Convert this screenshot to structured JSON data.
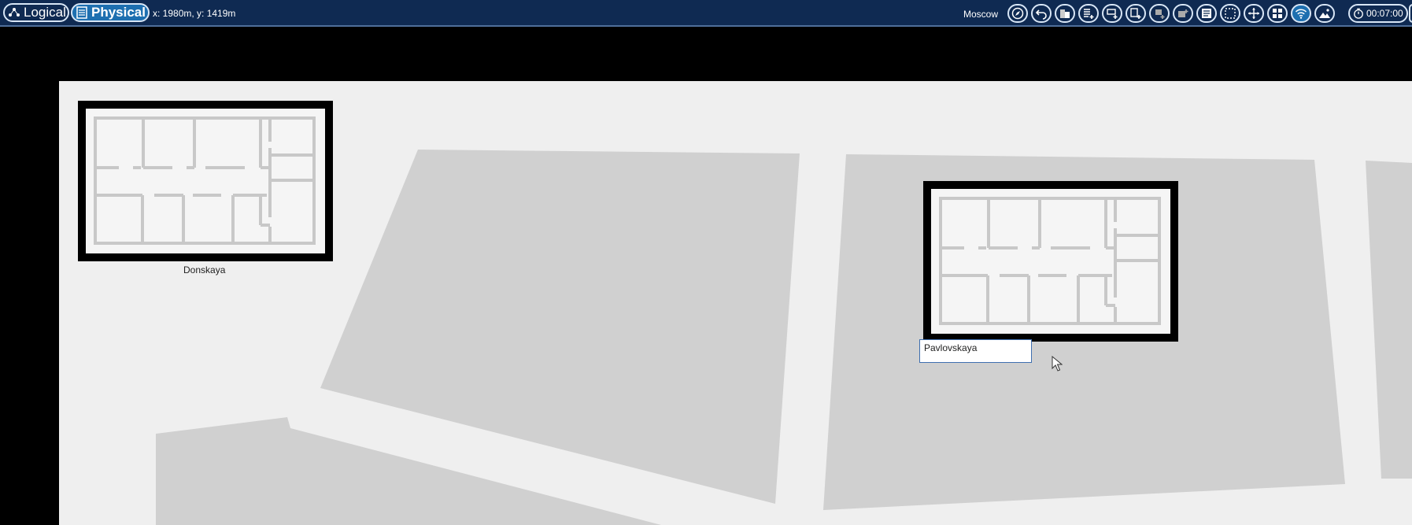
{
  "topbar": {
    "tabs": [
      {
        "label": "Logical",
        "icon": "network-icon",
        "active": false
      },
      {
        "label": "Physical",
        "icon": "list-icon",
        "active": true
      }
    ],
    "coordinates": "x: 1980m, y: 1419m",
    "location": "Moscow",
    "clock": "00:07:00",
    "tools": [
      "compass-icon",
      "undo-icon",
      "building-icon",
      "add-floor-icon",
      "add-room-icon",
      "add-zone-icon",
      "add-device-icon",
      "add-rack-icon",
      "notes-icon",
      "select-icon",
      "move-icon",
      "grid-icon",
      "wifi-icon",
      "background-image-icon",
      "timer-icon"
    ]
  },
  "map": {
    "buildings": [
      {
        "name": "Donskaya"
      },
      {
        "name": "Pavlovskaya",
        "editing": true
      }
    ]
  },
  "colors": {
    "topbar": "#0f2a52",
    "accent": "#1d6fb0",
    "map_bg": "#efefef",
    "block": "#d0d0d0"
  }
}
